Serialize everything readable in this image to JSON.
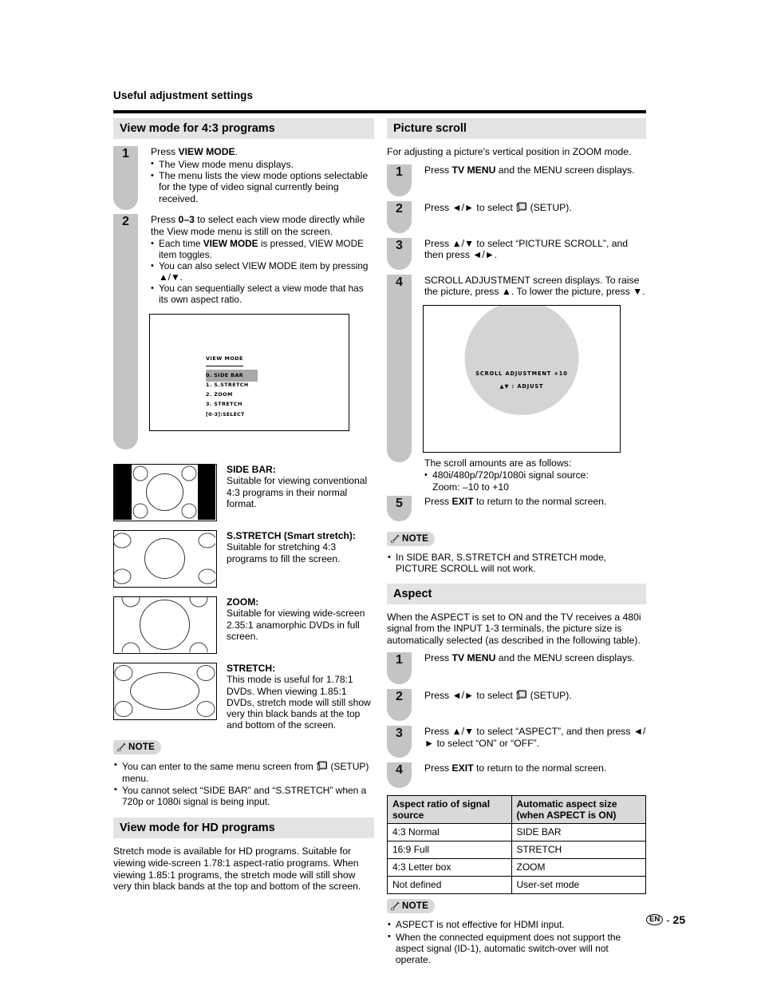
{
  "running_head": "Useful adjustment settings",
  "footer": {
    "lang_badge": "EN",
    "separator": "-",
    "page_number": "25"
  },
  "note_label": "NOTE",
  "left_column": {
    "section1": {
      "title": "View mode for 4:3 programs",
      "steps": [
        {
          "number": "1",
          "text_prefix": "Press ",
          "text_bold": "VIEW MODE",
          "text_suffix": ".",
          "bullets": [
            "The View mode menu displays.",
            "The menu lists the view mode options selectable for the type of video signal currently being received."
          ]
        },
        {
          "number": "2",
          "text_prefix": "Press ",
          "text_bold": "0–3",
          "text_suffix": " to select each view mode directly while the View mode menu is still on the screen.",
          "bullets": [
            "Each time VIEW MODE is pressed, VIEW MODE item toggles.",
            "You can also select VIEW MODE item by pressing ▲/▼.",
            "You can sequentially select a view mode that has its own aspect ratio."
          ]
        }
      ],
      "osd_menu": {
        "title": "VIEW MODE",
        "items": [
          {
            "label": "0. SIDE BAR",
            "highlighted": true
          },
          {
            "label": "1. S.STRETCH",
            "highlighted": false
          },
          {
            "label": "2. ZOOM",
            "highlighted": false
          },
          {
            "label": "3. STRETCH",
            "highlighted": false
          }
        ],
        "footer": "[0-3]:SELECT"
      },
      "view_modes": [
        {
          "figure": "side-bar-diagram",
          "name": "SIDE BAR:",
          "description": "Suitable for viewing conventional 4:3 programs in their normal format."
        },
        {
          "figure": "s-stretch-diagram",
          "name": "S.STRETCH (Smart stretch):",
          "description": "Suitable for stretching 4:3 programs to fill the screen."
        },
        {
          "figure": "zoom-diagram",
          "name": "ZOOM:",
          "description": "Suitable for viewing wide-screen 2.35:1 anamorphic DVDs in full screen."
        },
        {
          "figure": "stretch-diagram",
          "name": "STRETCH:",
          "description": "This mode is useful for 1.78:1 DVDs. When viewing 1.85:1 DVDs, stretch mode will still show very thin black bands at the top and bottom of the screen."
        }
      ],
      "notes": [
        "You can enter to the same menu screen from ［(SETUP) menu.",
        "You cannot select “SIDE BAR” and “S.STRETCH” when a 720p or 1080i signal is being input."
      ],
      "note1_part_a": "You can enter to the same menu screen from",
      "note1_part_b": "(SETUP) menu.",
      "note2": "You cannot select “SIDE BAR” and “S.STRETCH” when a 720p or 1080i signal is being input."
    },
    "section2": {
      "title": "View mode for HD programs",
      "body": "Stretch mode is available for HD programs. Suitable for viewing wide-screen 1.78:1 aspect-ratio programs. When viewing 1.85:1 programs, the stretch mode will still show very thin black bands at the top and bottom of the screen."
    }
  },
  "right_column": {
    "section_picture_scroll": {
      "title": "Picture scroll",
      "intro": "For adjusting a picture's vertical position in ZOOM mode.",
      "steps": [
        {
          "number": "1",
          "prefix": "Press ",
          "bold": "TV MENU",
          "suffix": " and the MENU screen displays."
        },
        {
          "number": "2",
          "prefix": "Press ◄/► to select ",
          "bold": "",
          "suffix": " (SETUP)."
        },
        {
          "number": "3",
          "prefix": "Press ▲/▼ to select “PICTURE SCROLL”, and then press ◄/►.",
          "bold": "",
          "suffix": ""
        },
        {
          "number": "4",
          "prefix": "SCROLL ADJUSTMENT screen displays. To raise the picture, press ▲. To lower the picture, press ▼.",
          "bold": "",
          "suffix": ""
        },
        {
          "number": "5",
          "prefix": "Press ",
          "bold": "EXIT",
          "suffix": " to return to the normal screen."
        }
      ],
      "osd_scroll": {
        "line1": "SCROLL ADJUSTMENT   +10",
        "line2": "▲▼ : ADJUST"
      },
      "scroll_amounts_heading": "The scroll amounts are as follows:",
      "scroll_amounts_bullet_line1": "480i/480p/720p/1080i signal source:",
      "scroll_amounts_bullet_line2": "Zoom: –10 to +10",
      "notes": [
        "In SIDE BAR, S.STRETCH and STRETCH mode, PICTURE SCROLL will not work."
      ]
    },
    "section_aspect": {
      "title": "Aspect",
      "intro": "When the ASPECT is set to ON and the TV receives a 480i signal from the INPUT 1-3 terminals, the picture size is automatically selected (as described in the following table).",
      "steps": [
        {
          "number": "1",
          "prefix": "Press ",
          "bold": "TV MENU",
          "suffix": " and the MENU screen displays."
        },
        {
          "number": "2",
          "prefix": "Press ◄/► to select ",
          "bold": "",
          "suffix": " (SETUP)."
        },
        {
          "number": "3",
          "prefix": "Press ▲/▼ to select “ASPECT”, and then press ◄/► to select “ON” or “OFF”.",
          "bold": "",
          "suffix": ""
        },
        {
          "number": "4",
          "prefix": "Press ",
          "bold": "EXIT",
          "suffix": " to return to the normal screen."
        }
      ],
      "table": {
        "headers": [
          "Aspect ratio of signal source",
          "Automatic aspect size (when ASPECT is ON)"
        ],
        "header_lines": [
          [
            "Aspect ratio of signal",
            "source"
          ],
          [
            "Automatic aspect size",
            "(when ASPECT is ON)"
          ]
        ],
        "rows": [
          [
            "4:3 Normal",
            "SIDE BAR"
          ],
          [
            "16:9 Full",
            "STRETCH"
          ],
          [
            "4:3 Letter box",
            "ZOOM"
          ],
          [
            "Not defined",
            "User-set mode"
          ]
        ]
      },
      "notes": [
        "ASPECT is not effective for HDMI input.",
        "When the connected equipment does not support the aspect signal (ID-1), automatic switch-over will not operate."
      ]
    }
  },
  "colors": {
    "section_header_bg": "#e3e3e3",
    "step_marker_bg": "#c4c4c4",
    "note_badge_bg": "#d8d8d8",
    "table_header_bg": "#d9d9d9",
    "osd_highlight_bg": "#a8a8a8",
    "osd_circle_fill": "#d4d4d4"
  }
}
